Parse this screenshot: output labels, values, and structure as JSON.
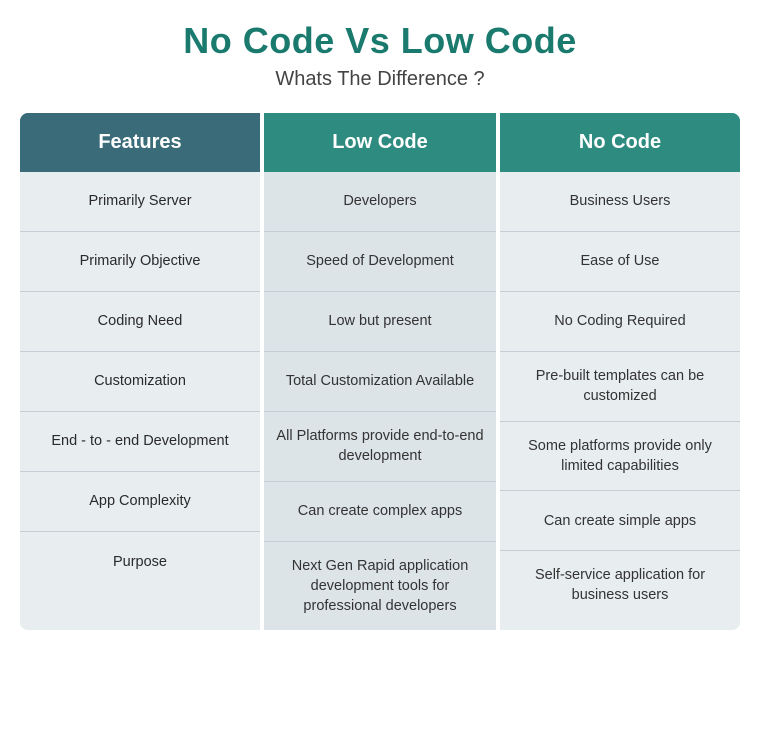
{
  "header": {
    "title": "No Code Vs Low Code",
    "subtitle": "Whats The Difference ?"
  },
  "columns": [
    {
      "header": "Features",
      "cells": [
        "Primarily Server",
        "Primarily Objective",
        "Coding Need",
        "Customization",
        "End - to - end Development",
        "App Complexity",
        "Purpose"
      ]
    },
    {
      "header": "Low Code",
      "cells": [
        "Developers",
        "Speed of Development",
        "Low but present",
        "Total Customization Available",
        "All Platforms provide end-to-end development",
        "Can create complex apps",
        "Next Gen Rapid application development tools for professional developers"
      ]
    },
    {
      "header": "No Code",
      "cells": [
        "Business Users",
        "Ease of Use",
        "No Coding Required",
        "Pre-built templates can be customized",
        "Some platforms provide only limited capabilities",
        "Can create simple apps",
        "Self-service application for business users"
      ]
    }
  ]
}
